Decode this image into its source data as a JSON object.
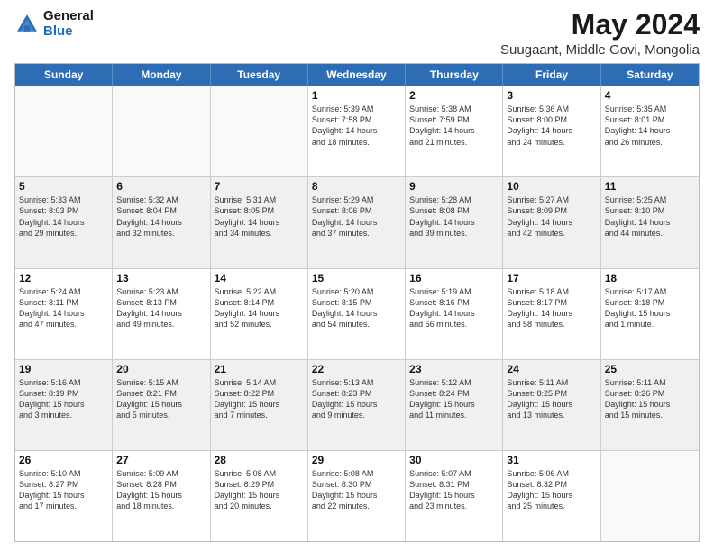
{
  "header": {
    "logo_general": "General",
    "logo_blue": "Blue",
    "main_title": "May 2024",
    "subtitle": "Suugaant, Middle Govi, Mongolia"
  },
  "calendar": {
    "days_of_week": [
      "Sunday",
      "Monday",
      "Tuesday",
      "Wednesday",
      "Thursday",
      "Friday",
      "Saturday"
    ],
    "rows": [
      [
        {
          "day": "",
          "info": "",
          "empty": true
        },
        {
          "day": "",
          "info": "",
          "empty": true
        },
        {
          "day": "",
          "info": "",
          "empty": true
        },
        {
          "day": "1",
          "info": "Sunrise: 5:39 AM\nSunset: 7:58 PM\nDaylight: 14 hours\nand 18 minutes.",
          "shaded": false
        },
        {
          "day": "2",
          "info": "Sunrise: 5:38 AM\nSunset: 7:59 PM\nDaylight: 14 hours\nand 21 minutes.",
          "shaded": false
        },
        {
          "day": "3",
          "info": "Sunrise: 5:36 AM\nSunset: 8:00 PM\nDaylight: 14 hours\nand 24 minutes.",
          "shaded": false
        },
        {
          "day": "4",
          "info": "Sunrise: 5:35 AM\nSunset: 8:01 PM\nDaylight: 14 hours\nand 26 minutes.",
          "shaded": false
        }
      ],
      [
        {
          "day": "5",
          "info": "Sunrise: 5:33 AM\nSunset: 8:03 PM\nDaylight: 14 hours\nand 29 minutes.",
          "shaded": true
        },
        {
          "day": "6",
          "info": "Sunrise: 5:32 AM\nSunset: 8:04 PM\nDaylight: 14 hours\nand 32 minutes.",
          "shaded": true
        },
        {
          "day": "7",
          "info": "Sunrise: 5:31 AM\nSunset: 8:05 PM\nDaylight: 14 hours\nand 34 minutes.",
          "shaded": true
        },
        {
          "day": "8",
          "info": "Sunrise: 5:29 AM\nSunset: 8:06 PM\nDaylight: 14 hours\nand 37 minutes.",
          "shaded": true
        },
        {
          "day": "9",
          "info": "Sunrise: 5:28 AM\nSunset: 8:08 PM\nDaylight: 14 hours\nand 39 minutes.",
          "shaded": true
        },
        {
          "day": "10",
          "info": "Sunrise: 5:27 AM\nSunset: 8:09 PM\nDaylight: 14 hours\nand 42 minutes.",
          "shaded": true
        },
        {
          "day": "11",
          "info": "Sunrise: 5:25 AM\nSunset: 8:10 PM\nDaylight: 14 hours\nand 44 minutes.",
          "shaded": true
        }
      ],
      [
        {
          "day": "12",
          "info": "Sunrise: 5:24 AM\nSunset: 8:11 PM\nDaylight: 14 hours\nand 47 minutes.",
          "shaded": false
        },
        {
          "day": "13",
          "info": "Sunrise: 5:23 AM\nSunset: 8:13 PM\nDaylight: 14 hours\nand 49 minutes.",
          "shaded": false
        },
        {
          "day": "14",
          "info": "Sunrise: 5:22 AM\nSunset: 8:14 PM\nDaylight: 14 hours\nand 52 minutes.",
          "shaded": false
        },
        {
          "day": "15",
          "info": "Sunrise: 5:20 AM\nSunset: 8:15 PM\nDaylight: 14 hours\nand 54 minutes.",
          "shaded": false
        },
        {
          "day": "16",
          "info": "Sunrise: 5:19 AM\nSunset: 8:16 PM\nDaylight: 14 hours\nand 56 minutes.",
          "shaded": false
        },
        {
          "day": "17",
          "info": "Sunrise: 5:18 AM\nSunset: 8:17 PM\nDaylight: 14 hours\nand 58 minutes.",
          "shaded": false
        },
        {
          "day": "18",
          "info": "Sunrise: 5:17 AM\nSunset: 8:18 PM\nDaylight: 15 hours\nand 1 minute.",
          "shaded": false
        }
      ],
      [
        {
          "day": "19",
          "info": "Sunrise: 5:16 AM\nSunset: 8:19 PM\nDaylight: 15 hours\nand 3 minutes.",
          "shaded": true
        },
        {
          "day": "20",
          "info": "Sunrise: 5:15 AM\nSunset: 8:21 PM\nDaylight: 15 hours\nand 5 minutes.",
          "shaded": true
        },
        {
          "day": "21",
          "info": "Sunrise: 5:14 AM\nSunset: 8:22 PM\nDaylight: 15 hours\nand 7 minutes.",
          "shaded": true
        },
        {
          "day": "22",
          "info": "Sunrise: 5:13 AM\nSunset: 8:23 PM\nDaylight: 15 hours\nand 9 minutes.",
          "shaded": true
        },
        {
          "day": "23",
          "info": "Sunrise: 5:12 AM\nSunset: 8:24 PM\nDaylight: 15 hours\nand 11 minutes.",
          "shaded": true
        },
        {
          "day": "24",
          "info": "Sunrise: 5:11 AM\nSunset: 8:25 PM\nDaylight: 15 hours\nand 13 minutes.",
          "shaded": true
        },
        {
          "day": "25",
          "info": "Sunrise: 5:11 AM\nSunset: 8:26 PM\nDaylight: 15 hours\nand 15 minutes.",
          "shaded": true
        }
      ],
      [
        {
          "day": "26",
          "info": "Sunrise: 5:10 AM\nSunset: 8:27 PM\nDaylight: 15 hours\nand 17 minutes.",
          "shaded": false
        },
        {
          "day": "27",
          "info": "Sunrise: 5:09 AM\nSunset: 8:28 PM\nDaylight: 15 hours\nand 18 minutes.",
          "shaded": false
        },
        {
          "day": "28",
          "info": "Sunrise: 5:08 AM\nSunset: 8:29 PM\nDaylight: 15 hours\nand 20 minutes.",
          "shaded": false
        },
        {
          "day": "29",
          "info": "Sunrise: 5:08 AM\nSunset: 8:30 PM\nDaylight: 15 hours\nand 22 minutes.",
          "shaded": false
        },
        {
          "day": "30",
          "info": "Sunrise: 5:07 AM\nSunset: 8:31 PM\nDaylight: 15 hours\nand 23 minutes.",
          "shaded": false
        },
        {
          "day": "31",
          "info": "Sunrise: 5:06 AM\nSunset: 8:32 PM\nDaylight: 15 hours\nand 25 minutes.",
          "shaded": false
        },
        {
          "day": "",
          "info": "",
          "empty": true
        }
      ]
    ]
  }
}
